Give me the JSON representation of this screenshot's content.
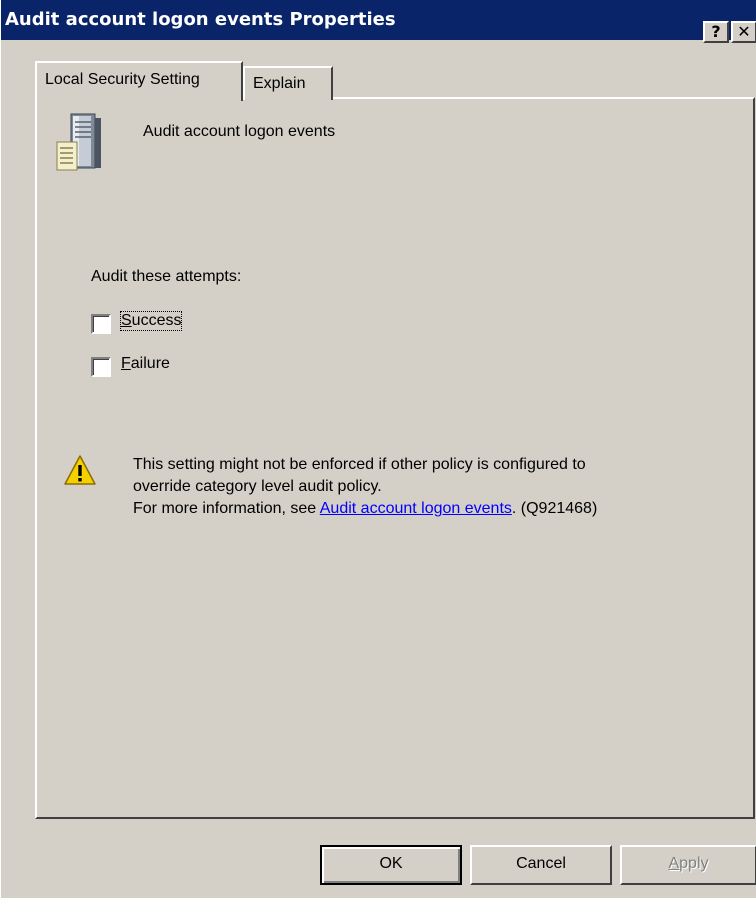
{
  "window": {
    "title": "Audit account logon events Properties",
    "help_button": "?",
    "close_button": "✕"
  },
  "tabs": [
    {
      "label": "Local Security Setting",
      "active": true
    },
    {
      "label": "Explain",
      "active": false
    }
  ],
  "policy": {
    "name": "Audit account logon events",
    "icon": "server-policy-icon"
  },
  "audit": {
    "label": "Audit these attempts:",
    "success": {
      "label": "Success",
      "mnemonic": "S",
      "rest": "uccess",
      "checked": false
    },
    "failure": {
      "label": "Failure",
      "mnemonic": "F",
      "rest": "ailure",
      "checked": false
    }
  },
  "warning": {
    "icon": "warning-icon",
    "line1": "This setting might not be enforced if other policy is configured to",
    "line2": "override category level audit policy.",
    "line3_prefix": "For more information, see ",
    "link_text": "Audit account logon events",
    "line3_suffix": ". (Q921468)"
  },
  "buttons": {
    "ok": "OK",
    "cancel": "Cancel",
    "apply_mnemonic": "A",
    "apply_rest": "pply",
    "apply_enabled": false
  },
  "colors": {
    "titlebar": "#0a246a",
    "dialog_bg": "#d4d0c8",
    "link": "#0000ff"
  }
}
